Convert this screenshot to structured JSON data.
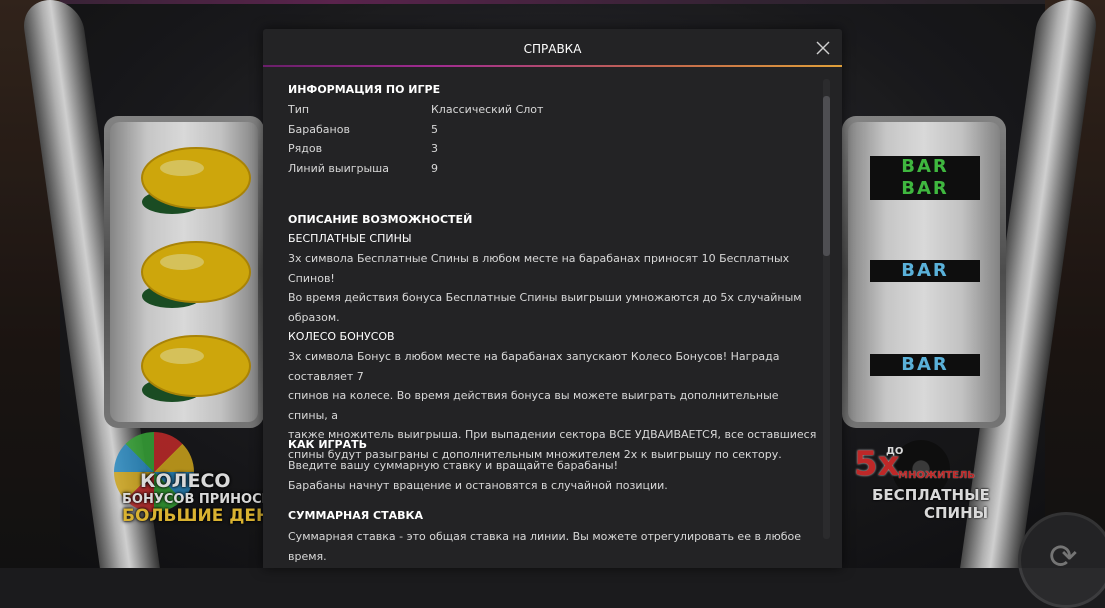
{
  "modal": {
    "title": "СПРАВКА",
    "game_info": {
      "heading": "ИНФОРМАЦИЯ ПО ИГРЕ",
      "rows": [
        {
          "key": "Тип",
          "value": "Классический Слот"
        },
        {
          "key": "Барабанов",
          "value": "5"
        },
        {
          "key": "Рядов",
          "value": "3"
        },
        {
          "key": "Линий выигрыша",
          "value": "9"
        }
      ]
    },
    "features": {
      "heading": "ОПИСАНИЕ ВОЗМОЖНОСТЕЙ",
      "free_spins": {
        "title": "БЕСПЛАТНЫЕ СПИНЫ",
        "lines": [
          "3x символа Бесплатные Спины в любом месте на барабанах приносят 10 Бесплатных Спинов!",
          "Во время действия бонуса Бесплатные Спины выигрыши умножаются до 5x случайным",
          "образом."
        ]
      },
      "bonus_wheel": {
        "title": "КОЛЕСО БОНУСОВ",
        "lines": [
          "3x символа Бонус в любом месте на барабанах запускают Колесо Бонусов! Награда составляет 7",
          "спинов на колесе. Во время действия бонуса вы можете выиграть дополнительные спины, а",
          "также множитель выигрыша. При выпадении сектора ВСЕ УДВАИВАЕТСЯ, все оставшиеся",
          "спины будут разыграны с дополнительным множителем 2x к выигрышу по сектору."
        ]
      }
    },
    "how_to_play": {
      "heading": "КАК ИГРАТЬ",
      "lines": [
        "Введите вашу суммарную ставку и вращайте барабаны!",
        "Барабаны начнут вращение и остановятся в случайной позиции."
      ]
    },
    "total_bet": {
      "heading": "СУММАРНАЯ СТАВКА",
      "lines": [
        "Суммарная ставка - это общая ставка на линии. Вы можете отрегулировать ее в любое время."
      ]
    }
  },
  "game": {
    "left_reel_symbols": [
      "lemon",
      "lemon",
      "lemon"
    ],
    "right_reel_symbols": [
      "BAR",
      "BAR",
      "BAR",
      "BAR"
    ],
    "promo_left": {
      "line1": "КОЛЕСО",
      "line2": "БОНУСОВ ПРИНОСИТ",
      "line3": "БОЛЬШИЕ ДЕНЬГИ"
    },
    "promo_right": {
      "multiplier": "5x",
      "prefix": "ДО",
      "mult_label": "МНОЖИТЕЛЬ",
      "line1": "БЕСПЛАТНЫЕ",
      "line2": "СПИНЫ"
    }
  },
  "colors": {
    "header_gradient_start": "#6a1f6a",
    "header_gradient_end": "#e0a03a",
    "modal_bg": "#232325"
  }
}
